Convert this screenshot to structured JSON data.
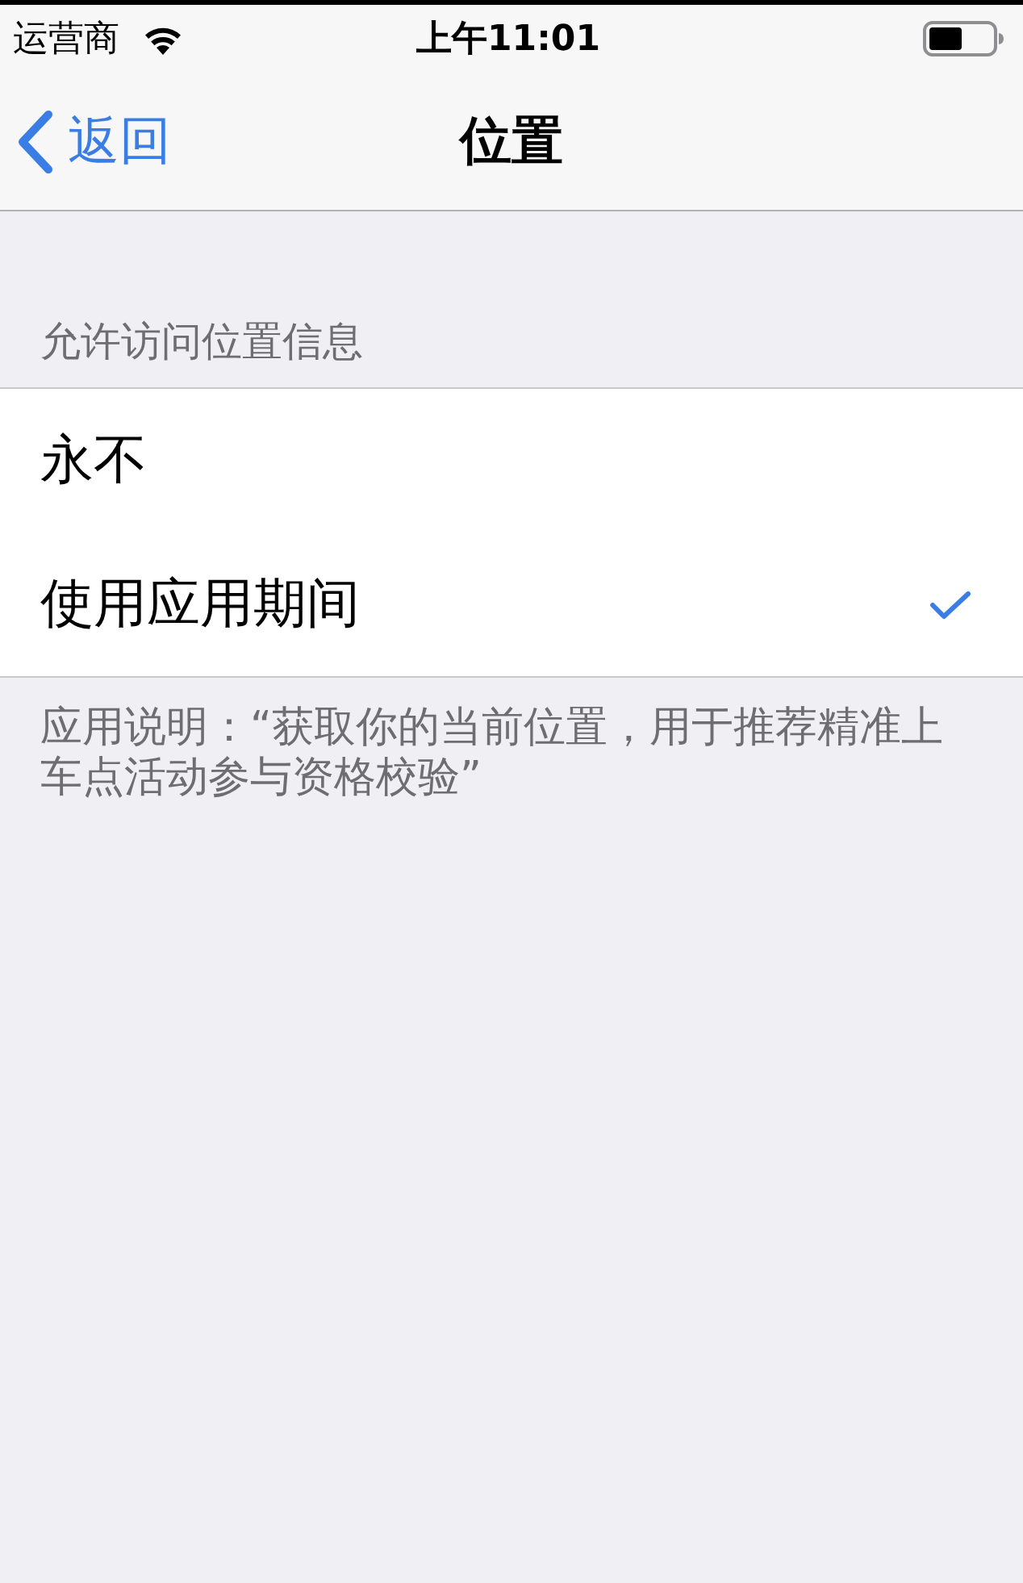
{
  "status_bar": {
    "carrier": "运营商",
    "time": "上午11:01"
  },
  "nav_bar": {
    "back_label": "返回",
    "title": "位置"
  },
  "section": {
    "header": "允许访问位置信息",
    "options": [
      {
        "label": "永不",
        "selected": false
      },
      {
        "label": "使用应用期间",
        "selected": true
      }
    ],
    "footer": "应用说明：“获取你的当前位置，用于推荐精准上车点活动参与资格校验”"
  }
}
